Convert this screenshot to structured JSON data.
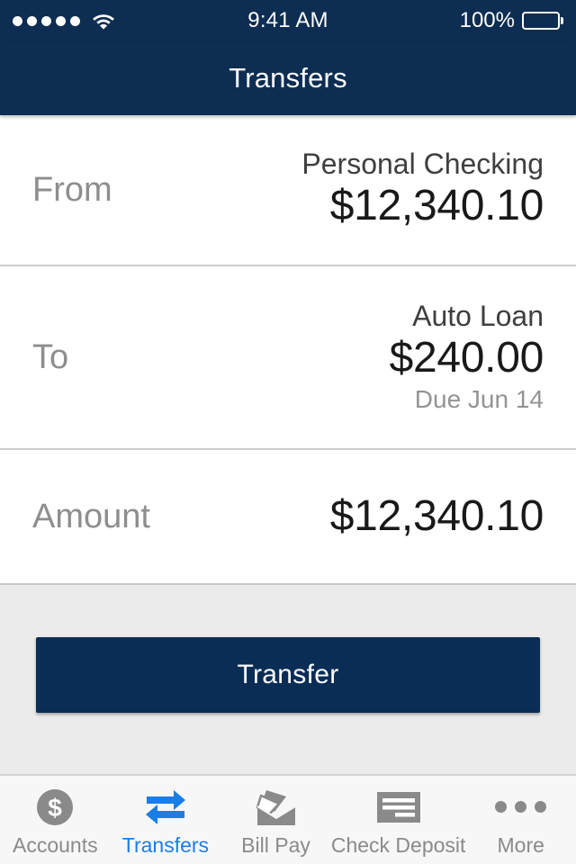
{
  "status_bar": {
    "signal_dots": 5,
    "wifi_icon": "wifi-icon",
    "time": "9:41 AM",
    "battery_percent": "100%",
    "battery_icon": "battery-full-icon"
  },
  "header": {
    "title": "Transfers"
  },
  "form": {
    "rows": [
      {
        "label": "From",
        "account_name": "Personal Checking",
        "amount": "$12,340.10",
        "sub": ""
      },
      {
        "label": "To",
        "account_name": "Auto Loan",
        "amount": "$240.00",
        "sub": "Due Jun 14"
      },
      {
        "label": "Amount",
        "account_name": "",
        "amount": "$12,340.10",
        "sub": ""
      }
    ]
  },
  "action": {
    "transfer_label": "Transfer"
  },
  "tab_bar": {
    "active_index": 1,
    "tabs": [
      {
        "label": "Accounts",
        "icon": "dollar-circle-icon"
      },
      {
        "label": "Transfers",
        "icon": "two-way-arrows-icon"
      },
      {
        "label": "Bill Pay",
        "icon": "envelope-mail-icon"
      },
      {
        "label": "Check Deposit",
        "icon": "check-document-icon"
      },
      {
        "label": "More",
        "icon": "ellipsis-icon"
      }
    ]
  },
  "colors": {
    "navy": "#0d2d52",
    "button_navy": "#0a2d55",
    "accent_blue": "#1a7ee8",
    "panel_gray": "#ebebeb",
    "tabbar_gray": "#f7f7f7",
    "icon_gray": "#8a8a8a",
    "label_gray": "#8e8e8e",
    "value_dark": "#191919",
    "divider": "#cdcdcd"
  }
}
